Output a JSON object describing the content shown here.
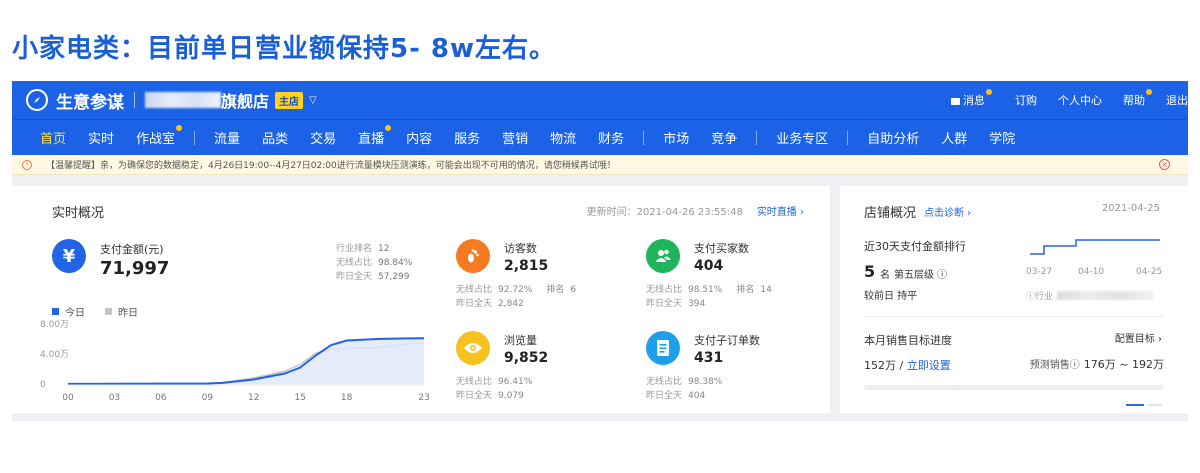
{
  "headline": "小家电类：目前单日营业额保持5- 8w左右。",
  "header": {
    "brand": "生意参谋",
    "shop_suffix": "旗舰店",
    "shop_badge": "主店",
    "links": [
      "消息",
      "订购",
      "个人中心",
      "帮助",
      "退出"
    ]
  },
  "nav": {
    "group1": [
      "首页",
      "实时",
      "作战室"
    ],
    "group2": [
      "流量",
      "品类",
      "交易",
      "直播",
      "内容",
      "服务",
      "营销",
      "物流",
      "财务"
    ],
    "group3": [
      "市场",
      "竞争"
    ],
    "group4": [
      "业务专区"
    ],
    "group5": [
      "自助分析",
      "人群",
      "学院"
    ]
  },
  "notice": {
    "text": "【温馨提醒】亲，为确保您的数据稳定，4月26日19:00--4月27日02:00进行流量模块压测演练，可能会出现不可用的情况，请您稍候再试哦！"
  },
  "realtime": {
    "title": "实时概况",
    "updated_label": "更新时间：",
    "updated_time": "2021-04-26 23:55:48",
    "live_link": "实时直播 ›",
    "payment": {
      "label": "支付金额(元)",
      "value": "71,997",
      "stats": [
        {
          "label": "行业排名",
          "value": "12"
        },
        {
          "label": "无线占比",
          "value": "98.84%"
        },
        {
          "label": "昨日全天",
          "value": "57,299"
        }
      ]
    },
    "metrics": [
      {
        "label": "访客数",
        "value": "2,815",
        "ratio_label": "无线占比",
        "ratio": "92.72%",
        "rank_label": "排名",
        "rank": "6",
        "yday_label": "昨日全天",
        "yday": "2,842"
      },
      {
        "label": "支付买家数",
        "value": "404",
        "ratio_label": "无线占比",
        "ratio": "98.51%",
        "rank_label": "排名",
        "rank": "14",
        "yday_label": "昨日全天",
        "yday": "394"
      },
      {
        "label": "浏览量",
        "value": "9,852",
        "ratio_label": "无线占比",
        "ratio": "96.41%",
        "yday_label": "昨日全天",
        "yday": "9,079"
      },
      {
        "label": "支付子订单数",
        "value": "431",
        "ratio_label": "无线占比",
        "ratio": "98.38%",
        "yday_label": "昨日全天",
        "yday": "404"
      }
    ],
    "colors": {
      "accent": "#2264e6",
      "visitor": "#f47b22",
      "buyer": "#1fb35c",
      "pv": "#f6c21d",
      "order": "#1ea0e8"
    },
    "icons": {
      "payment": "yen-icon",
      "visitor": "footprint-icon",
      "buyer": "users-icon",
      "pv": "eye-icon",
      "order": "document-icon"
    }
  },
  "chart_data": {
    "type": "area",
    "series": [
      {
        "name": "今日",
        "color": "#2264e6",
        "x": [
          0,
          3,
          6,
          9,
          10,
          12,
          14,
          15,
          16,
          17,
          18,
          20,
          22,
          23
        ],
        "values": [
          200,
          300,
          450,
          600,
          1500,
          6000,
          14000,
          22000,
          38000,
          52000,
          58000,
          60000,
          60800,
          61000
        ]
      },
      {
        "name": "昨日",
        "color": "#c4c4c4",
        "x": [
          0,
          3,
          6,
          9,
          10,
          12,
          14,
          15,
          16,
          17,
          18,
          20,
          22,
          23
        ],
        "values": [
          300,
          400,
          500,
          700,
          2000,
          8000,
          17000,
          26000,
          41000,
          46000,
          47500,
          48500,
          53500,
          54500
        ]
      }
    ],
    "xticks": [
      "00",
      "03",
      "06",
      "09",
      "12",
      "15",
      "18",
      "23"
    ],
    "yticks": [
      "8.00万",
      "4.00万",
      "0"
    ],
    "ylim": [
      0,
      80000
    ],
    "legend": "top-left"
  },
  "store": {
    "title": "店铺概况",
    "diag_link": "点击诊断 ›",
    "date": "2021-04-25",
    "rank_label": "近30天支付金额排行",
    "rank_value": "5",
    "rank_unit": "名",
    "rank_level": "第五层级 ⓘ",
    "prev_compare": "较前日  持平",
    "industry_label": "ⓘ行业",
    "mini_xticks": [
      "03-27",
      "04-10",
      "04-25"
    ],
    "goal_label": "本月销售目标进度",
    "goal_config": "配置目标 ›",
    "goal_current": "152万 / ",
    "goal_link": "立即设置",
    "forecast_label": "预测销售ⓘ",
    "forecast_value": "176万 ~ 192万",
    "goal_progress": 0
  }
}
